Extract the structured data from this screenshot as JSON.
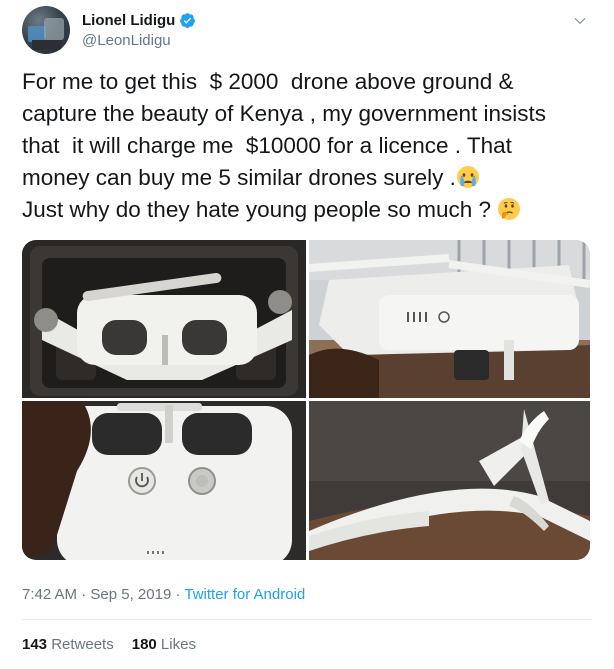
{
  "user": {
    "display_name": "Lionel Lidigu",
    "handle": "@LeonLidigu"
  },
  "tweet": {
    "line1": "For me to get this  $ 2000  drone above ground &",
    "line2": "capture the beauty of Kenya , my government insists",
    "line3": "that  it will charge me  $10000 for a licence . That",
    "line4": "money can buy me 5 similar drones surely .",
    "line5": "Just why do they hate young people so much ? ",
    "emoji1": "crying-face-emoji",
    "emoji2": "thinking-face-emoji"
  },
  "meta": {
    "time": "7:42 AM",
    "separator": " · ",
    "date": "Sep 5, 2019",
    "separator2": " · ",
    "source": "Twitter for Android"
  },
  "stats": {
    "retweets_count": "143",
    "retweets_label": " Retweets",
    "likes_count": "180",
    "likes_label": " Likes"
  },
  "colors": {
    "link": "#1da1f2",
    "secondary_text": "#657786",
    "verified": "#1da1f2"
  }
}
